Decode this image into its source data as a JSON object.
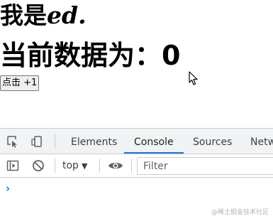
{
  "page": {
    "title_prefix": "我是",
    "title_name": "ed.",
    "counter_label": "当前数据为：",
    "counter_value": "0",
    "button_label": "点击 +1"
  },
  "devtools": {
    "tabs": [
      {
        "label": "Elements",
        "active": false
      },
      {
        "label": "Console",
        "active": true
      },
      {
        "label": "Sources",
        "active": false
      },
      {
        "label": "Netw",
        "active": false
      }
    ],
    "context": "top",
    "filter_placeholder": "Filter",
    "prompt_symbol": "›",
    "accent_color": "#1a73e8"
  },
  "watermark": "@稀土掘金技术社区"
}
